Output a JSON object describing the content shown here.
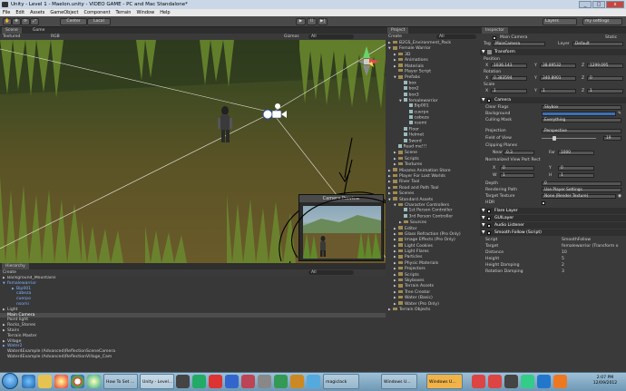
{
  "window": {
    "title": "Unity - Level 1 - Maelon.unity - VIDEO GAME - PC and Mac Standalone*",
    "min": "_",
    "max": "□",
    "close": "x"
  },
  "menu": [
    "File",
    "Edit",
    "Assets",
    "GameObject",
    "Component",
    "Terrain",
    "Window",
    "Help"
  ],
  "toolbar": {
    "center": "Center",
    "local": "Local",
    "play": "▶",
    "pause": "II",
    "step": "▶|",
    "layers": "Layers",
    "layout": "my settings"
  },
  "scene_tabs": {
    "scene": "Scene",
    "game": "Game"
  },
  "scene_opts": {
    "mode": "Textured",
    "render": "RGB",
    "gizmos": "Gizmos",
    "search": "All"
  },
  "camera_preview": {
    "title": "Camera Preview"
  },
  "hierarchy": {
    "tab": "Hierarchy",
    "create": "Create",
    "search": "All",
    "items": [
      {
        "label": "Background_Mountains",
        "indent": 0,
        "arrow": "▶"
      },
      {
        "label": "femalewarrior",
        "indent": 0,
        "arrow": "▼",
        "blue": true
      },
      {
        "label": "Bip001",
        "indent": 2,
        "arrow": "▶",
        "blue": true
      },
      {
        "label": "cabeza",
        "indent": 2,
        "arrow": "",
        "blue": true
      },
      {
        "label": "cuerpo",
        "indent": 2,
        "arrow": "",
        "blue": true
      },
      {
        "label": "nsomi",
        "indent": 2,
        "arrow": "",
        "blue": true
      },
      {
        "label": "Light",
        "indent": 0,
        "arrow": "▶"
      },
      {
        "label": "Main Camera",
        "indent": 0,
        "arrow": "",
        "selected": true
      },
      {
        "label": "Point light",
        "indent": 0,
        "arrow": ""
      },
      {
        "label": "Rocks_Stones",
        "indent": 0,
        "arrow": "▶"
      },
      {
        "label": "Stairs",
        "indent": 0,
        "arrow": "▶"
      },
      {
        "label": "Terrain Master",
        "indent": 0,
        "arrow": ""
      },
      {
        "label": "Village",
        "indent": 0,
        "arrow": "▶"
      },
      {
        "label": "Water2",
        "indent": 0,
        "arrow": "▶",
        "blue": true
      },
      {
        "label": "Water4Example (Advanced)ReflectionSceneCamera",
        "indent": 0,
        "arrow": ""
      },
      {
        "label": "Water4Example (Advanced)ReflectionVillage_Cam",
        "indent": 0,
        "arrow": ""
      }
    ]
  },
  "project": {
    "tab": "Project",
    "create": "Create",
    "search": "All",
    "items": [
      {
        "label": "B2GS_Environment_Pack",
        "indent": 0,
        "arrow": "▶",
        "kind": "folder"
      },
      {
        "label": "Female Warrior",
        "indent": 0,
        "arrow": "▼",
        "kind": "folder"
      },
      {
        "label": "3D",
        "indent": 1,
        "arrow": "▶",
        "kind": "folder"
      },
      {
        "label": "Animations",
        "indent": 1,
        "arrow": "▶",
        "kind": "folder"
      },
      {
        "label": "Materials",
        "indent": 1,
        "arrow": "▶",
        "kind": "folder"
      },
      {
        "label": "Player Script",
        "indent": 1,
        "arrow": "",
        "kind": "folder"
      },
      {
        "label": "Prefabs",
        "indent": 1,
        "arrow": "▼",
        "kind": "folder"
      },
      {
        "label": "box",
        "indent": 2,
        "arrow": "",
        "kind": "file"
      },
      {
        "label": "box2",
        "indent": 2,
        "arrow": "",
        "kind": "file"
      },
      {
        "label": "box3",
        "indent": 2,
        "arrow": "",
        "kind": "file"
      },
      {
        "label": "femalewarrior",
        "indent": 2,
        "arrow": "▼",
        "kind": "file"
      },
      {
        "label": "Bip001",
        "indent": 3,
        "arrow": "",
        "kind": "file"
      },
      {
        "label": "cuerpo",
        "indent": 3,
        "arrow": "",
        "kind": "file"
      },
      {
        "label": "cabeza",
        "indent": 3,
        "arrow": "",
        "kind": "file"
      },
      {
        "label": "nsomi",
        "indent": 3,
        "arrow": "",
        "kind": "file"
      },
      {
        "label": "Floor",
        "indent": 2,
        "arrow": "",
        "kind": "file"
      },
      {
        "label": "Helmet",
        "indent": 2,
        "arrow": "",
        "kind": "file"
      },
      {
        "label": "Sword",
        "indent": 2,
        "arrow": "",
        "kind": "file"
      },
      {
        "label": "Read me!!!",
        "indent": 1,
        "arrow": "",
        "kind": "file"
      },
      {
        "label": "Scene",
        "indent": 1,
        "arrow": "▶",
        "kind": "folder"
      },
      {
        "label": "Scripts",
        "indent": 1,
        "arrow": "▶",
        "kind": "folder"
      },
      {
        "label": "Textures",
        "indent": 1,
        "arrow": "▶",
        "kind": "folder"
      },
      {
        "label": "Mixamo Animation Store",
        "indent": 0,
        "arrow": "▶",
        "kind": "folder"
      },
      {
        "label": "Player For Lost Worlds",
        "indent": 0,
        "arrow": "▶",
        "kind": "folder"
      },
      {
        "label": "River Tool",
        "indent": 0,
        "arrow": "▶",
        "kind": "folder"
      },
      {
        "label": "Road and Path Tool",
        "indent": 0,
        "arrow": "▶",
        "kind": "folder"
      },
      {
        "label": "Scenes",
        "indent": 0,
        "arrow": "▶",
        "kind": "folder"
      },
      {
        "label": "Standard Assets",
        "indent": 0,
        "arrow": "▼",
        "kind": "folder"
      },
      {
        "label": "Character Controllers",
        "indent": 1,
        "arrow": "▼",
        "kind": "folder"
      },
      {
        "label": "1st Person Controller",
        "indent": 2,
        "arrow": "",
        "kind": "file"
      },
      {
        "label": "3rd Person Controller",
        "indent": 2,
        "arrow": "",
        "kind": "file"
      },
      {
        "label": "Sources",
        "indent": 2,
        "arrow": "▶",
        "kind": "folder"
      },
      {
        "label": "Editor",
        "indent": 1,
        "arrow": "▶",
        "kind": "folder"
      },
      {
        "label": "Glass Refraction (Pro Only)",
        "indent": 1,
        "arrow": "▶",
        "kind": "folder"
      },
      {
        "label": "Image Effects (Pro Only)",
        "indent": 1,
        "arrow": "▶",
        "kind": "folder"
      },
      {
        "label": "Light Cookies",
        "indent": 1,
        "arrow": "▶",
        "kind": "folder"
      },
      {
        "label": "Light Flares",
        "indent": 1,
        "arrow": "▶",
        "kind": "folder"
      },
      {
        "label": "Particles",
        "indent": 1,
        "arrow": "▶",
        "kind": "folder"
      },
      {
        "label": "Physic Materials",
        "indent": 1,
        "arrow": "▶",
        "kind": "folder"
      },
      {
        "label": "Projectors",
        "indent": 1,
        "arrow": "▶",
        "kind": "folder"
      },
      {
        "label": "Scripts",
        "indent": 1,
        "arrow": "▶",
        "kind": "folder"
      },
      {
        "label": "Skyboxes",
        "indent": 1,
        "arrow": "▶",
        "kind": "folder"
      },
      {
        "label": "Terrain Assets",
        "indent": 1,
        "arrow": "▶",
        "kind": "folder"
      },
      {
        "label": "Tree Creator",
        "indent": 1,
        "arrow": "▶",
        "kind": "folder"
      },
      {
        "label": "Water (Basic)",
        "indent": 1,
        "arrow": "▶",
        "kind": "folder"
      },
      {
        "label": "Water (Pro Only)",
        "indent": 1,
        "arrow": "▶",
        "kind": "folder"
      },
      {
        "label": "Terrain Objects",
        "indent": 0,
        "arrow": "▶",
        "kind": "folder"
      }
    ]
  },
  "inspector": {
    "tab": "Inspector",
    "object_name": "Main Camera",
    "static_label": "Static",
    "tag_label": "Tag",
    "tag_value": "MainCamera",
    "layer_label": "Layer",
    "layer_value": "Default",
    "transform": {
      "title": "Transform",
      "position_label": "Position",
      "position": {
        "x": "1036.143",
        "y": "38.89532",
        "z": "1299.095"
      },
      "rotation_label": "Rotation",
      "rotation": {
        "x": "0.383594",
        "y": "340.8901",
        "z": "0"
      },
      "scale_label": "Scale",
      "scale": {
        "x": "1",
        "y": "1",
        "z": "1"
      }
    },
    "camera": {
      "title": "Camera",
      "clear_flags_label": "Clear Flags",
      "clear_flags": "Skybox",
      "background_label": "Background",
      "culling_mask_label": "Culling Mask",
      "culling_mask": "Everything",
      "projection_label": "Projection",
      "projection": "Perspective",
      "fov_label": "Field of View",
      "fov": "19",
      "clipping_label": "Clipping Planes",
      "near_label": "Near",
      "near": "0.3",
      "far_label": "Far",
      "far": "1000",
      "viewport_label": "Normalized View Port Rect",
      "vx": "0",
      "vy": "0",
      "vw": "1",
      "vh": "1",
      "depth_label": "Depth",
      "depth": "0",
      "rendering_path_label": "Rendering Path",
      "rendering_path": "Use Player Settings",
      "target_texture_label": "Target Texture",
      "target_texture": "None (Render Texture)",
      "hdr_label": "HDR"
    },
    "components": [
      {
        "title": "Flare Layer"
      },
      {
        "title": "GUILayer"
      },
      {
        "title": "Audio Listener"
      },
      {
        "title": "Smooth Follow (Script)"
      }
    ],
    "smooth_follow": [
      {
        "label": "Script",
        "value": "SmoothFollow"
      },
      {
        "label": "Target",
        "value": "femalewarrior (Transform o"
      },
      {
        "label": "Distance",
        "value": "10"
      },
      {
        "label": "Height",
        "value": "5"
      },
      {
        "label": "Height Damping",
        "value": "2"
      },
      {
        "label": "Rotation Damping",
        "value": "3"
      }
    ]
  },
  "taskbar": {
    "items": [
      "How To Set ...",
      "Unity - Level...",
      "magiclack",
      "Windows U...",
      "Windows U..."
    ],
    "time": "2:07 PM",
    "date": "12/09/2012"
  },
  "colors": {
    "accent": "#3d6fb6",
    "selection": "#4d4d4d",
    "annotation": "#000000",
    "gizmo": "#ffffff"
  }
}
